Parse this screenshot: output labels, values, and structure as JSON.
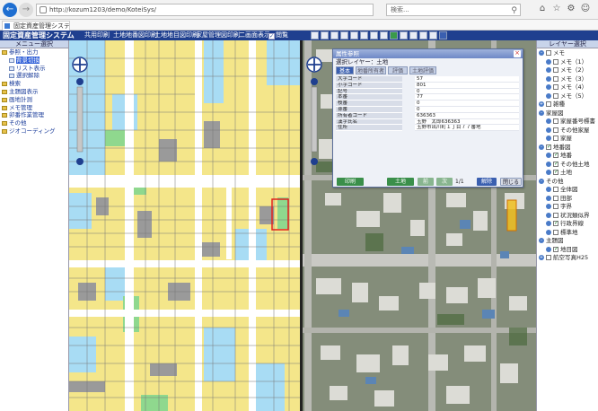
{
  "browser": {
    "url": "http://kozum1203/demo/KoteiSys/",
    "search_placeholder": "検索...",
    "tab_title": "固定資産管理システム",
    "colors": {
      "accent": "#1f6fd1"
    }
  },
  "header": {
    "title": "固定資産管理システム",
    "toolbar": [
      {
        "label": "共用印刷"
      },
      {
        "label": "土地地番図印刷"
      },
      {
        "label": "土地地目図印刷"
      },
      {
        "label": "家屋管理図印刷"
      },
      {
        "label": "二画面表示"
      },
      {
        "label": "閲覧",
        "checked": true
      }
    ],
    "colors": {
      "bar": "#1f3f8f"
    }
  },
  "left_panel": {
    "title": "メニュー選択",
    "items": [
      {
        "label": "参照・出力",
        "level": 0
      },
      {
        "label": "背景切換",
        "level": 1,
        "selected": true
      },
      {
        "label": "リスト表示",
        "level": 1
      },
      {
        "label": "選択解除",
        "level": 1
      },
      {
        "label": "検索",
        "level": 0
      },
      {
        "label": "主題図表示",
        "level": 0
      },
      {
        "label": "画地計測",
        "level": 0
      },
      {
        "label": "メモ管理",
        "level": 0
      },
      {
        "label": "卯番作業管理",
        "level": 0
      },
      {
        "label": "その他",
        "level": 0
      },
      {
        "label": "ジオコーディング",
        "level": 0
      }
    ]
  },
  "right_panel": {
    "title": "レイヤー選択",
    "layers": [
      {
        "label": "メモ",
        "level": 0,
        "expand": "-",
        "checked": false
      },
      {
        "label": "メモ（1）",
        "level": 1,
        "checked": false
      },
      {
        "label": "メモ（2）",
        "level": 1,
        "checked": false
      },
      {
        "label": "メモ（3）",
        "level": 1,
        "checked": false
      },
      {
        "label": "メモ（4）",
        "level": 1,
        "checked": false
      },
      {
        "label": "メモ（5）",
        "level": 1,
        "checked": false
      },
      {
        "label": "雑種",
        "level": 0,
        "expand": "+",
        "checked": false
      },
      {
        "label": "家屋図",
        "level": 0,
        "expand": "-",
        "checked": null
      },
      {
        "label": "家屋番号標書",
        "level": 1,
        "checked": false
      },
      {
        "label": "その他家屋",
        "level": 1,
        "checked": false
      },
      {
        "label": "家屋",
        "level": 1,
        "checked": false
      },
      {
        "label": "地番図",
        "level": 0,
        "expand": "-",
        "checked": true
      },
      {
        "label": "地番",
        "level": 1,
        "checked": true
      },
      {
        "label": "その他土地",
        "level": 1,
        "checked": true
      },
      {
        "label": "土地",
        "level": 1,
        "checked": true
      },
      {
        "label": "その他",
        "level": 0,
        "expand": "-",
        "checked": null
      },
      {
        "label": "全体図",
        "level": 1,
        "checked": false
      },
      {
        "label": "田部",
        "level": 1,
        "checked": false
      },
      {
        "label": "字界",
        "level": 1,
        "checked": false
      },
      {
        "label": "状況類似界",
        "level": 1,
        "checked": false
      },
      {
        "label": "行政界線",
        "level": 1,
        "checked": true
      },
      {
        "label": "標準地",
        "level": 1,
        "checked": false
      },
      {
        "label": "主題図",
        "level": 0,
        "expand": "-",
        "checked": null
      },
      {
        "label": "地目図",
        "level": 1,
        "checked": true
      },
      {
        "label": "航空写真H25",
        "level": 0,
        "expand": "+",
        "checked": false
      }
    ]
  },
  "dialog": {
    "title": "属性参照",
    "layer_label": "選択レイヤー：土地",
    "tabs": [
      {
        "label": "基本",
        "active": true
      },
      {
        "label": "地番所有者",
        "active": false
      },
      {
        "label": "評価",
        "active": false
      },
      {
        "label": "土地評価",
        "active": false
      }
    ],
    "attributes": [
      {
        "key": "大字コード",
        "value": "57"
      },
      {
        "key": "小字コード",
        "value": "801"
      },
      {
        "key": "記号",
        "value": "0"
      },
      {
        "key": "本番",
        "value": "77"
      },
      {
        "key": "枝番",
        "value": "0"
      },
      {
        "key": "孫番",
        "value": "0"
      },
      {
        "key": "所有者コード",
        "value": "636363"
      },
      {
        "key": "漢字氏名",
        "value": "玉野　太郎636363"
      },
      {
        "key": "住所",
        "value": "玉野市出川町１丁目７７番地"
      }
    ],
    "buttons": {
      "print": "印刷",
      "land": "土地",
      "prev": "前",
      "next": "次",
      "page": "1/1",
      "cancel": "解除",
      "close": "閉じる"
    }
  }
}
